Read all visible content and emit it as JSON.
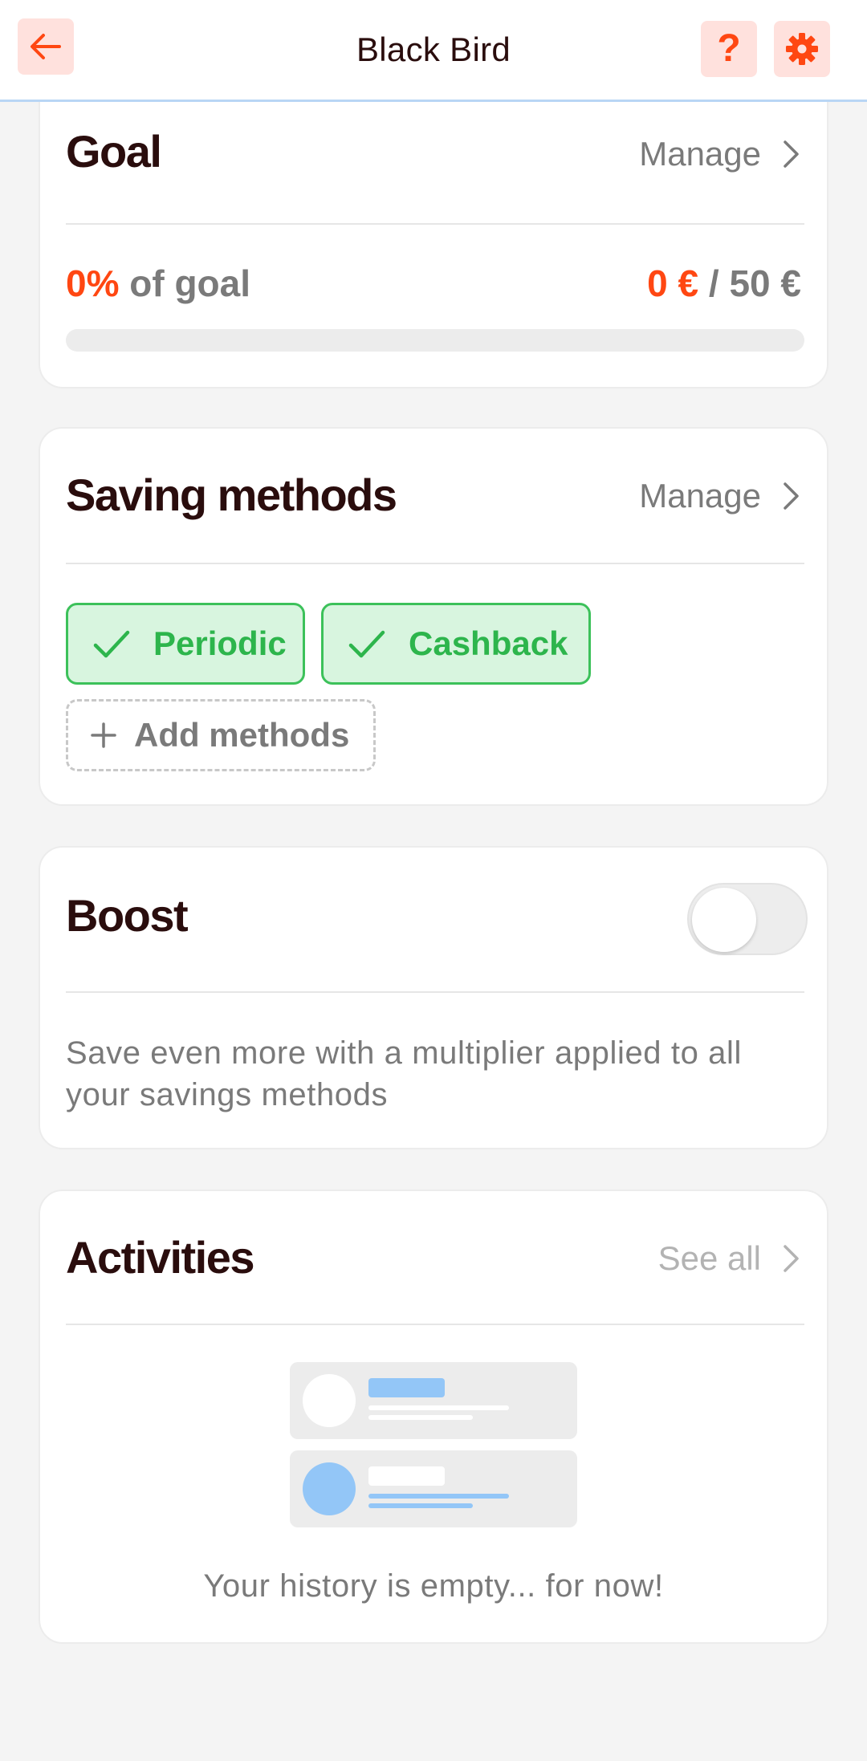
{
  "header": {
    "title": "Black Bird",
    "back_icon": "arrow-left-icon",
    "help_label": "?",
    "settings_icon": "gear-icon",
    "accent": "#ff4712"
  },
  "goal": {
    "title": "Goal",
    "manage_label": "Manage",
    "percent": "0%",
    "percent_suffix": " of goal",
    "current": "0 €",
    "separator": " / ",
    "target": "50 €",
    "progress_fraction": 0
  },
  "saving_methods": {
    "title": "Saving methods",
    "manage_label": "Manage",
    "methods": [
      {
        "label": "Periodic",
        "active": true
      },
      {
        "label": "Cashback",
        "active": true
      }
    ],
    "add_label": "Add methods",
    "active_color": "#2db54c"
  },
  "boost": {
    "title": "Boost",
    "enabled": false,
    "description": "Save even more with a multiplier applied to all your savings methods"
  },
  "activities": {
    "title": "Activities",
    "see_all_label": "See all",
    "empty_text": "Your history is empty... for now!"
  }
}
